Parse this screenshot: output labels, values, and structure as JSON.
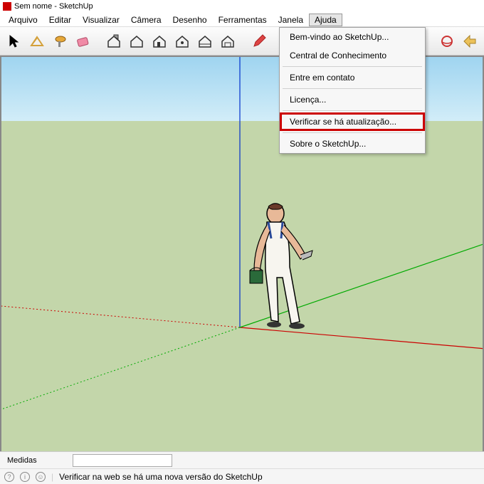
{
  "titlebar": {
    "title": "Sem nome - SketchUp"
  },
  "menubar": {
    "items": [
      "Arquivo",
      "Editar",
      "Visualizar",
      "Câmera",
      "Desenho",
      "Ferramentas",
      "Janela",
      "Ajuda"
    ]
  },
  "dropdown": {
    "items": [
      "Bem-vindo ao SketchUp...",
      "Central de Conhecimento",
      "Entre em contato",
      "Licença...",
      "Verificar se há atualização...",
      "Sobre o SketchUp..."
    ],
    "highlighted_index": 4
  },
  "bottom_panel": {
    "label": "Medidas"
  },
  "statusbar": {
    "message": "Verificar na web se há uma nova versão do SketchUp"
  },
  "icons": {
    "q": "?",
    "i": "i",
    "p": "☺"
  }
}
